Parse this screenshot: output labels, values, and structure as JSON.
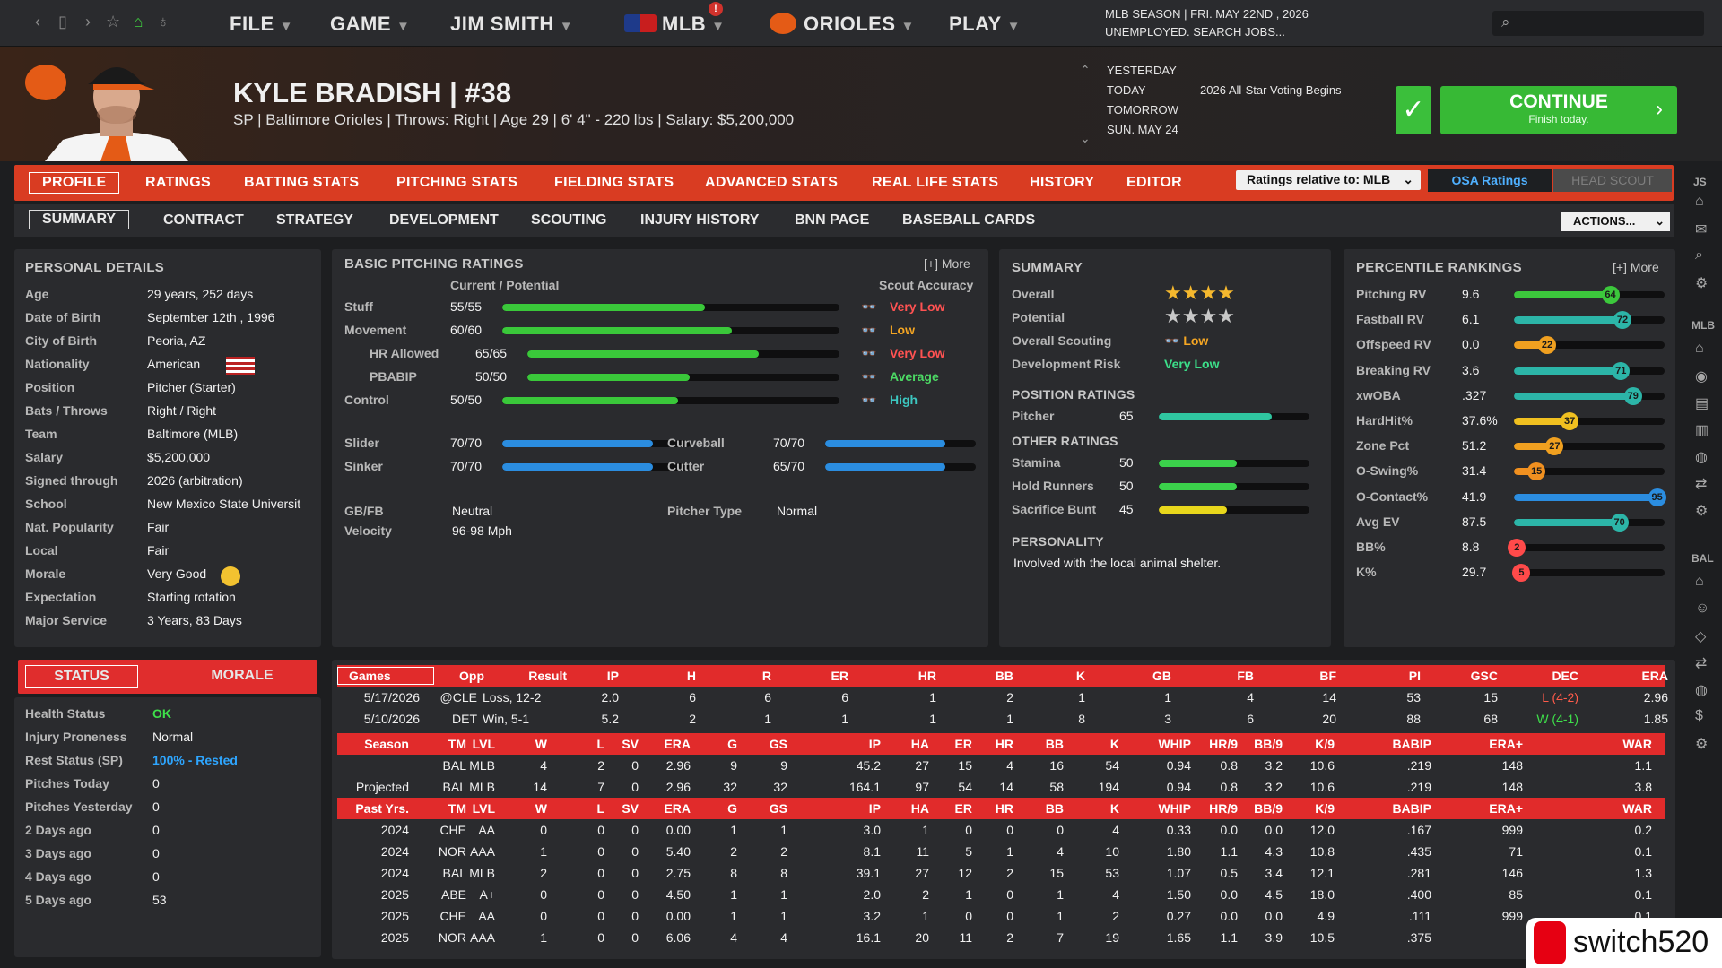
{
  "topbar": {
    "menus": [
      "FILE",
      "GAME",
      "JIM SMITH",
      "MLB",
      "ORIOLES",
      "PLAY"
    ],
    "mlb_badge": "!",
    "season_line1": "MLB SEASON  |  FRI. MAY 22ND , 2026",
    "season_line2": "UNEMPLOYED. SEARCH JOBS..."
  },
  "player": {
    "name": "KYLE BRADISH  |  #38",
    "subtitle": "SP | Baltimore Orioles  |  Throws: Right  |  Age 29  |  6' 4\"  - 220 lbs  |  Salary: $5,200,000"
  },
  "dates": {
    "yesterday": "YESTERDAY",
    "today": "TODAY",
    "tomorrow": "TOMORROW",
    "sun": "SUN. MAY 24",
    "event": "2026 All-Star Voting Begins"
  },
  "continue": {
    "label": "CONTINUE",
    "sub": "Finish today."
  },
  "tabs1": [
    "PROFILE",
    "RATINGS",
    "BATTING STATS",
    "PITCHING STATS",
    "FIELDING STATS",
    "ADVANCED STATS",
    "REAL LIFE STATS",
    "HISTORY",
    "EDITOR"
  ],
  "ratings_select": "Ratings relative to: MLB",
  "osa": "OSA Ratings",
  "head_scout": "HEAD SCOUT",
  "tabs2": [
    "SUMMARY",
    "CONTRACT",
    "STRATEGY",
    "DEVELOPMENT",
    "SCOUTING",
    "INJURY HISTORY",
    "BNN PAGE",
    "BASEBALL CARDS"
  ],
  "actions": "ACTIONS...",
  "personal": {
    "title": "PERSONAL DETAILS",
    "rows": [
      [
        "Age",
        "29 years, 252 days"
      ],
      [
        "Date of Birth",
        "September 12th , 1996"
      ],
      [
        "City of Birth",
        "Peoria, AZ"
      ],
      [
        "Nationality",
        "American"
      ],
      [
        "Position",
        "Pitcher (Starter)"
      ],
      [
        "Bats / Throws",
        "Right / Right"
      ],
      [
        "Team",
        "Baltimore (MLB)"
      ],
      [
        "Salary",
        "$5,200,000"
      ],
      [
        "Signed through",
        "2026 (arbitration)"
      ],
      [
        "School",
        "New Mexico State Universit"
      ],
      [
        "Nat. Popularity",
        "Fair"
      ],
      [
        "Local",
        "Fair"
      ],
      [
        "Morale",
        "Very Good"
      ],
      [
        "Expectation",
        "Starting rotation"
      ],
      [
        "Major Service",
        "3 Years, 83 Days"
      ]
    ]
  },
  "basic": {
    "title": "BASIC PITCHING RATINGS",
    "more": "[+] More",
    "col1": "Current / Potential",
    "col2": "Scout Accuracy",
    "rows": [
      {
        "name": "Stuff",
        "val": "55/55",
        "pct": 0.6,
        "acc": "Very Low",
        "ac": "#ff5252"
      },
      {
        "name": "Movement",
        "val": "60/60",
        "pct": 0.68,
        "acc": "Low",
        "ac": "#f5a623"
      },
      {
        "name": "HR Allowed",
        "val": "65/65",
        "pct": 0.74,
        "acc": "Very Low",
        "ac": "#ff5252"
      },
      {
        "name": "PBABIP",
        "val": "50/50",
        "pct": 0.52,
        "acc": "Average",
        "ac": "#4cd964"
      },
      {
        "name": "Control",
        "val": "50/50",
        "pct": 0.52,
        "acc": "High",
        "ac": "#3cc7c0"
      }
    ],
    "pitches": [
      {
        "name": "Slider",
        "val": "70/70",
        "pct": 0.8
      },
      {
        "name": "Sinker",
        "val": "70/70",
        "pct": 0.8
      },
      {
        "name": "Curveball",
        "val": "70/70",
        "pct": 0.8
      },
      {
        "name": "Cutter",
        "val": "65/70",
        "pct": 0.8
      }
    ],
    "gbfb_l": "GB/FB",
    "gbfb": "Neutral",
    "velo_l": "Velocity",
    "velo": "96-98 Mph",
    "ptype_l": "Pitcher Type",
    "ptype": "Normal"
  },
  "summary": {
    "title": "SUMMARY",
    "overall_l": "Overall",
    "potential_l": "Potential",
    "overall_stars": 4,
    "potential_stars": 4,
    "scouting_l": "Overall Scouting",
    "scouting": "Low",
    "devrisk_l": "Development Risk",
    "devrisk": "Very Low",
    "pos_title": "POSITION RATINGS",
    "pos": [
      {
        "name": "Pitcher",
        "val": "65",
        "pct": 0.75,
        "color": "#2fc6a0"
      }
    ],
    "other_title": "OTHER RATINGS",
    "other": [
      {
        "name": "Stamina",
        "val": "50",
        "pct": 0.52,
        "color": "#3bd14b"
      },
      {
        "name": "Hold Runners",
        "val": "50",
        "pct": 0.52,
        "color": "#3bd14b"
      },
      {
        "name": "Sacrifice Bunt",
        "val": "45",
        "pct": 0.45,
        "color": "#e8d71c"
      }
    ],
    "pers_title": "PERSONALITY",
    "pers": "Involved with the local animal shelter."
  },
  "percentile": {
    "title": "PERCENTILE RANKINGS",
    "more": "[+] More",
    "rows": [
      {
        "n": "Pitching RV",
        "v": "9.6",
        "p": 64,
        "c": "#3cc83c"
      },
      {
        "n": "Fastball RV",
        "v": "6.1",
        "p": 72,
        "c": "#2cb5a8"
      },
      {
        "n": "Offspeed RV",
        "v": "0.0",
        "p": 22,
        "c": "#f0a020"
      },
      {
        "n": "Breaking RV",
        "v": "3.6",
        "p": 71,
        "c": "#2cb5a8"
      },
      {
        "n": "xwOBA",
        "v": ".327",
        "p": 79,
        "c": "#2cb5a8"
      },
      {
        "n": "HardHit%",
        "v": "37.6%",
        "p": 37,
        "c": "#f0c020"
      },
      {
        "n": "Zone Pct",
        "v": "51.2",
        "p": 27,
        "c": "#f0a020"
      },
      {
        "n": "O-Swing%",
        "v": "31.4",
        "p": 15,
        "c": "#f09020"
      },
      {
        "n": "O-Contact%",
        "v": "41.9",
        "p": 95,
        "c": "#2b8de0"
      },
      {
        "n": "Avg EV",
        "v": "87.5",
        "p": 70,
        "c": "#2cb5a8"
      },
      {
        "n": "BB%",
        "v": "8.8",
        "p": 2,
        "c": "#ff4a4a"
      },
      {
        "n": "K%",
        "v": "29.7",
        "p": 5,
        "c": "#ff4a4a"
      }
    ]
  },
  "status": {
    "tab1": "STATUS",
    "tab2": "MORALE",
    "rows": [
      [
        "Health Status",
        "OK"
      ],
      [
        "Injury Proneness",
        "Normal"
      ],
      [
        "Rest Status (SP)",
        "100% - Rested"
      ],
      [
        "Pitches Today",
        "0"
      ],
      [
        "Pitches Yesterday",
        "0"
      ],
      [
        "2 Days ago",
        "0"
      ],
      [
        "3 Days ago",
        "0"
      ],
      [
        "4 Days ago",
        "0"
      ],
      [
        "5 Days ago",
        "53"
      ]
    ]
  },
  "games": {
    "select": "Games",
    "hdr": [
      "Opp",
      "Result",
      "IP",
      "H",
      "R",
      "ER",
      "HR",
      "BB",
      "K",
      "GB",
      "FB",
      "BF",
      "PI",
      "GSC",
      "DEC",
      "ERA"
    ],
    "rows": [
      [
        "5/17/2026",
        "@CLE",
        "Loss, 12-2",
        "2.0",
        "6",
        "6",
        "6",
        "1",
        "2",
        "1",
        "1",
        "4",
        "14",
        "53",
        "15",
        "L (4-2)",
        "2.96"
      ],
      [
        "5/10/2026",
        "DET",
        "Win, 5-1",
        "5.2",
        "2",
        "1",
        "1",
        "1",
        "1",
        "8",
        "3",
        "6",
        "20",
        "88",
        "68",
        "W (4-1)",
        "1.85"
      ]
    ]
  },
  "season": {
    "hdr": [
      "Season",
      "TM",
      "LVL",
      "W",
      "L",
      "SV",
      "ERA",
      "G",
      "GS",
      "IP",
      "HA",
      "ER",
      "HR",
      "BB",
      "K",
      "WHIP",
      "HR/9",
      "BB/9",
      "K/9",
      "BABIP",
      "ERA+",
      "WAR"
    ],
    "rows": [
      [
        "",
        "BAL",
        "MLB",
        "4",
        "2",
        "0",
        "2.96",
        "9",
        "9",
        "45.2",
        "27",
        "15",
        "4",
        "16",
        "54",
        "0.94",
        "0.8",
        "3.2",
        "10.6",
        ".219",
        "148",
        "1.1"
      ],
      [
        "Projected",
        "BAL",
        "MLB",
        "14",
        "7",
        "0",
        "2.96",
        "32",
        "32",
        "164.1",
        "97",
        "54",
        "14",
        "58",
        "194",
        "0.94",
        "0.8",
        "3.2",
        "10.6",
        ".219",
        "148",
        "3.8"
      ]
    ]
  },
  "past": {
    "hdr": [
      "Past Yrs.",
      "TM",
      "LVL",
      "W",
      "L",
      "SV",
      "ERA",
      "G",
      "GS",
      "IP",
      "HA",
      "ER",
      "HR",
      "BB",
      "K",
      "WHIP",
      "HR/9",
      "BB/9",
      "K/9",
      "BABIP",
      "ERA+",
      "WAR"
    ],
    "rows": [
      [
        "2024",
        "CHE",
        "AA",
        "0",
        "0",
        "0",
        "0.00",
        "1",
        "1",
        "3.0",
        "1",
        "0",
        "0",
        "0",
        "4",
        "0.33",
        "0.0",
        "0.0",
        "12.0",
        ".167",
        "999",
        "0.2"
      ],
      [
        "2024",
        "NOR",
        "AAA",
        "1",
        "0",
        "0",
        "5.40",
        "2",
        "2",
        "8.1",
        "11",
        "5",
        "1",
        "4",
        "10",
        "1.80",
        "1.1",
        "4.3",
        "10.8",
        ".435",
        "71",
        "0.1"
      ],
      [
        "2024",
        "BAL",
        "MLB",
        "2",
        "0",
        "0",
        "2.75",
        "8",
        "8",
        "39.1",
        "27",
        "12",
        "2",
        "15",
        "53",
        "1.07",
        "0.5",
        "3.4",
        "12.1",
        ".281",
        "146",
        "1.3"
      ],
      [
        "2025",
        "ABE",
        "A+",
        "0",
        "0",
        "0",
        "4.50",
        "1",
        "1",
        "2.0",
        "2",
        "1",
        "0",
        "1",
        "4",
        "1.50",
        "0.0",
        "4.5",
        "18.0",
        ".400",
        "85",
        "0.1"
      ],
      [
        "2025",
        "CHE",
        "AA",
        "0",
        "0",
        "0",
        "0.00",
        "1",
        "1",
        "3.2",
        "1",
        "0",
        "0",
        "1",
        "2",
        "0.27",
        "0.0",
        "0.0",
        "4.9",
        ".111",
        "999",
        "0.1"
      ],
      [
        "2025",
        "NOR",
        "AAA",
        "1",
        "0",
        "0",
        "6.06",
        "4",
        "4",
        "16.1",
        "20",
        "11",
        "2",
        "7",
        "19",
        "1.65",
        "1.1",
        "3.9",
        "10.5",
        ".375",
        "",
        ""
      ]
    ]
  },
  "sidebar": {
    "js": "JS",
    "mlb": "MLB",
    "bal": "BAL"
  },
  "watermark": "switch520"
}
